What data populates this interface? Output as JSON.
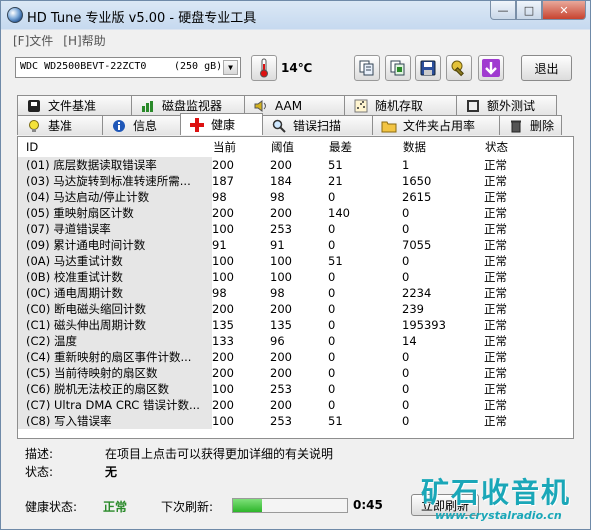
{
  "window": {
    "title": "HD Tune 专业版 v5.00 - 硬盘专业工具"
  },
  "menu": [
    {
      "label": "[F]文件"
    },
    {
      "label": "[H]帮助"
    }
  ],
  "drive": {
    "name": "WDC WD2500BEVT-22ZCT0",
    "size": "(250 gB)"
  },
  "temperature": "14℃",
  "exit_label": "退出",
  "tabs_top": [
    {
      "label": "文件基准",
      "icon": "file-benchmark-icon"
    },
    {
      "label": "磁盘监视器",
      "icon": "disk-monitor-icon"
    },
    {
      "label": "AAM",
      "icon": "speaker-icon"
    },
    {
      "label": "随机存取",
      "icon": "random-access-icon"
    },
    {
      "label": "额外测试",
      "icon": "extra-tests-icon"
    }
  ],
  "tabs_bottom": [
    {
      "label": "基准",
      "icon": "lightbulb-icon"
    },
    {
      "label": "信息",
      "icon": "info-icon"
    },
    {
      "label": "健康",
      "icon": "health-cross-icon",
      "active": true
    },
    {
      "label": "错误扫描",
      "icon": "magnifier-icon"
    },
    {
      "label": "文件夹占用率",
      "icon": "folder-icon"
    },
    {
      "label": "删除",
      "icon": "trash-icon"
    }
  ],
  "table": {
    "headers": {
      "id": "ID",
      "current": "当前",
      "threshold": "阈值",
      "worst": "最差",
      "data": "数据",
      "status": "状态"
    },
    "rows": [
      {
        "id": "(01) 底层数据读取错误率",
        "current": "200",
        "threshold": "200",
        "worst": "51",
        "data": "1",
        "status": "正常"
      },
      {
        "id": "(03) 马达旋转到标准转速所需...",
        "current": "187",
        "threshold": "184",
        "worst": "21",
        "data": "1650",
        "status": "正常"
      },
      {
        "id": "(04) 马达启动/停止计数",
        "current": "98",
        "threshold": "98",
        "worst": "0",
        "data": "2615",
        "status": "正常"
      },
      {
        "id": "(05) 重映射扇区计数",
        "current": "200",
        "threshold": "200",
        "worst": "140",
        "data": "0",
        "status": "正常"
      },
      {
        "id": "(07) 寻道错误率",
        "current": "100",
        "threshold": "253",
        "worst": "0",
        "data": "0",
        "status": "正常"
      },
      {
        "id": "(09) 累计通电时间计数",
        "current": "91",
        "threshold": "91",
        "worst": "0",
        "data": "7055",
        "status": "正常"
      },
      {
        "id": "(0A) 马达重试计数",
        "current": "100",
        "threshold": "100",
        "worst": "51",
        "data": "0",
        "status": "正常"
      },
      {
        "id": "(0B) 校准重试计数",
        "current": "100",
        "threshold": "100",
        "worst": "0",
        "data": "0",
        "status": "正常"
      },
      {
        "id": "(0C) 通电周期计数",
        "current": "98",
        "threshold": "98",
        "worst": "0",
        "data": "2234",
        "status": "正常"
      },
      {
        "id": "(C0) 断电磁头缩回计数",
        "current": "200",
        "threshold": "200",
        "worst": "0",
        "data": "239",
        "status": "正常"
      },
      {
        "id": "(C1) 磁头伸出周期计数",
        "current": "135",
        "threshold": "135",
        "worst": "0",
        "data": "195393",
        "status": "正常"
      },
      {
        "id": "(C2) 温度",
        "current": "133",
        "threshold": "96",
        "worst": "0",
        "data": "14",
        "status": "正常"
      },
      {
        "id": "(C4) 重新映射的扇区事件计数...",
        "current": "200",
        "threshold": "200",
        "worst": "0",
        "data": "0",
        "status": "正常"
      },
      {
        "id": "(C5) 当前待映射的扇区数",
        "current": "200",
        "threshold": "200",
        "worst": "0",
        "data": "0",
        "status": "正常"
      },
      {
        "id": "(C6) 脱机无法校正的扇区数",
        "current": "100",
        "threshold": "253",
        "worst": "0",
        "data": "0",
        "status": "正常"
      },
      {
        "id": "(C7) Ultra DMA CRC 错误计数...",
        "current": "200",
        "threshold": "200",
        "worst": "0",
        "data": "0",
        "status": "正常"
      },
      {
        "id": "(C8) 写入错误率",
        "current": "100",
        "threshold": "253",
        "worst": "51",
        "data": "0",
        "status": "正常"
      }
    ]
  },
  "description": {
    "label": "描述:",
    "text": "在项目上点击可以获得更加详细的有关说明",
    "status_label": "状态:",
    "status_text": "无"
  },
  "footer": {
    "health_label": "健康状态:",
    "health_value": "正常",
    "next_refresh_label": "下次刷新:",
    "progress": 0.25,
    "time": "0:45",
    "refresh_button": "立即刷新"
  },
  "watermark": {
    "brand": "矿石收音机",
    "url": "www.crystalradio.cn"
  },
  "colors": {
    "health_ok": "#2a8a2a",
    "progress": "#2db52a"
  }
}
